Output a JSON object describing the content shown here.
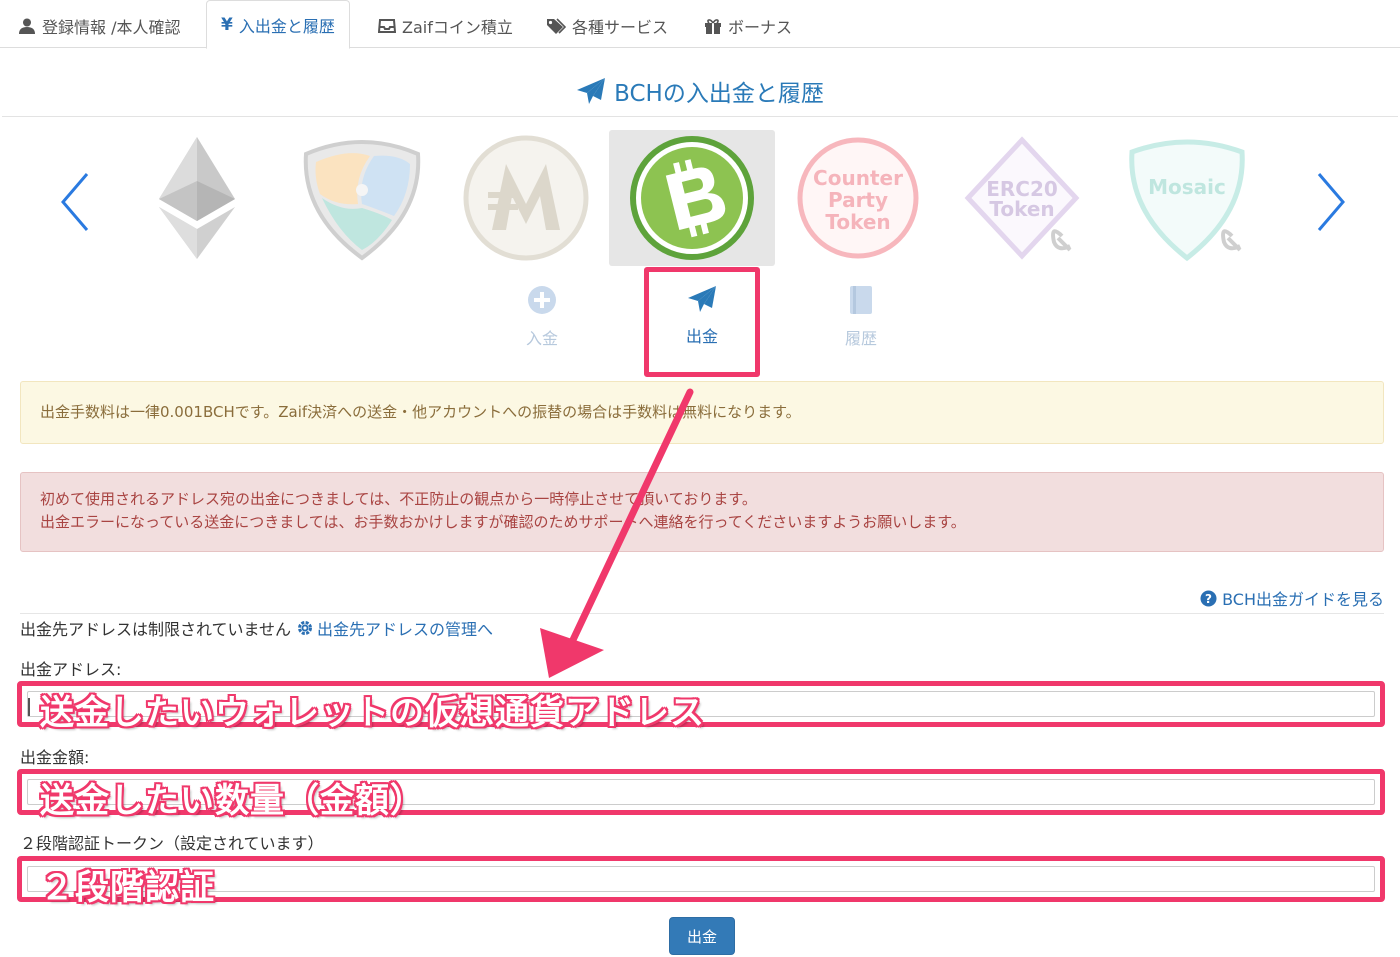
{
  "tabs": [
    {
      "label": "登録情報 /本人確認",
      "icon": "user-icon"
    },
    {
      "label": "入出金と履歴",
      "icon": "yen-icon",
      "active": true
    },
    {
      "label": "Zaifコイン積立",
      "icon": "inbox-icon"
    },
    {
      "label": "各種サービス",
      "icon": "tags-icon"
    },
    {
      "label": "ボーナス",
      "icon": "gift-icon"
    }
  ],
  "page_title": "BCHの入出金と履歴",
  "coins": [
    {
      "name": "ETH",
      "selected": false
    },
    {
      "name": "XEM",
      "selected": false
    },
    {
      "name": "MONA",
      "selected": false
    },
    {
      "name": "BCH",
      "selected": true
    },
    {
      "name": "Counter Party Token",
      "line1": "Counter",
      "line2": "Party",
      "line3": "Token",
      "selected": false
    },
    {
      "name": "ERC20 Token",
      "line1": "ERC20",
      "line2": "Token",
      "selected": false
    },
    {
      "name": "Mosaic",
      "line1": "Mosaic",
      "selected": false
    }
  ],
  "actions": {
    "deposit": "入金",
    "withdraw": "出金",
    "history": "履歴",
    "active": "withdraw"
  },
  "alerts": {
    "fee_notice": "出金手数料は一律0.001BCHです。Zaif決済への送金・他アカウントへの振替の場合は手数料は無料になります。",
    "warning_line1": "初めて使用されるアドレス宛の出金につきましては、不正防止の観点から一時停止させて頂いております。",
    "warning_line2": "出金エラーになっている送金につきましては、お手数おかけしますが確認のためサポートへ連絡を行ってくださいますようお願いします。"
  },
  "guide_link": "BCH出金ガイドを見る",
  "address_status": {
    "text": "出金先アドレスは制限されていません",
    "link": "出金先アドレスの管理へ"
  },
  "form": {
    "address_label": "出金アドレス:",
    "address_annotation": "送金したいウォレットの仮想通貨アドレス",
    "amount_label": "出金金額:",
    "amount_annotation": "送金したい数量（金額）",
    "token_label": "２段階認証トークン（設定されています）",
    "token_annotation": "２段階認証",
    "submit_label": "出金"
  },
  "colors": {
    "accent": "#2a7ab8",
    "highlight": "#f0386b",
    "bch_green": "#8dc351",
    "button": "#337ab7"
  }
}
